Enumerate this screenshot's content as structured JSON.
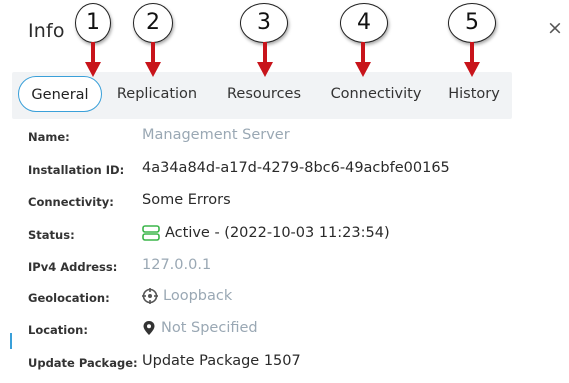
{
  "dialog": {
    "title": "Info",
    "close_glyph": "×"
  },
  "tabs": [
    {
      "label": "General",
      "active": true
    },
    {
      "label": "Replication",
      "active": false
    },
    {
      "label": "Resources",
      "active": false
    },
    {
      "label": "Connectivity",
      "active": false
    },
    {
      "label": "History",
      "active": false
    }
  ],
  "callouts": [
    "1",
    "2",
    "3",
    "4",
    "5"
  ],
  "fields": [
    {
      "label": "Name:",
      "value": "Management Server",
      "muted": true,
      "icon": null
    },
    {
      "label": "Installation ID:",
      "value": "4a34a84d-a17d-4279-8bc6-49acbfe00165",
      "muted": false,
      "icon": null
    },
    {
      "label": "Connectivity:",
      "value": "Some Errors",
      "muted": false,
      "icon": null
    },
    {
      "label": "Status:",
      "value": "Active -  (2022-10-03 11:23:54)",
      "muted": false,
      "icon": "server-status-icon"
    },
    {
      "label": "IPv4 Address:",
      "value": "127.0.0.1",
      "muted": true,
      "icon": null
    },
    {
      "label": "Geolocation:",
      "value": "Loopback",
      "muted": true,
      "icon": "crosshair-icon"
    },
    {
      "label": "Location:",
      "value": "Not Specified",
      "muted": true,
      "icon": "map-pin-icon"
    },
    {
      "label": "Update Package:",
      "value": "Update Package 1507",
      "muted": false,
      "icon": null
    }
  ],
  "colors": {
    "accent": "#3aa0d9",
    "status_green": "#3bb54a",
    "arrow_red": "#c8141b",
    "muted_text": "#9aa8b4"
  }
}
